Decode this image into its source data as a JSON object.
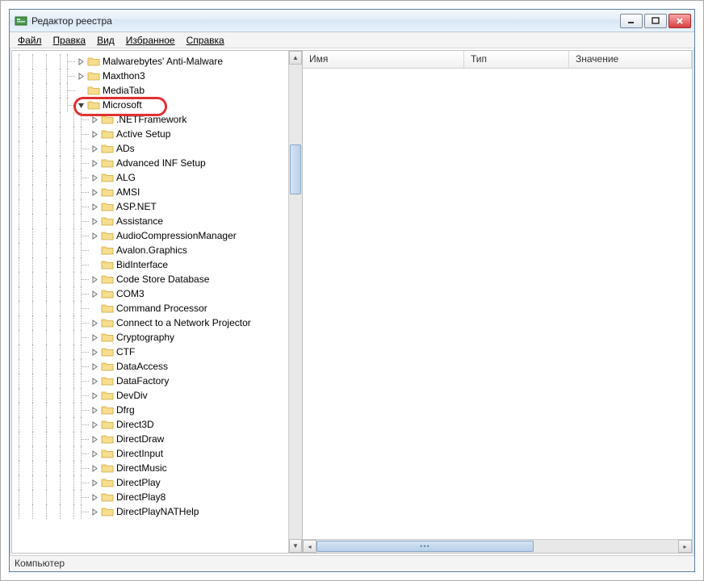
{
  "window": {
    "title": "Редактор реестра"
  },
  "menu": {
    "file": "Файл",
    "edit": "Правка",
    "view": "Вид",
    "favorites": "Избранное",
    "help": "Справка"
  },
  "tree": {
    "top": [
      {
        "label": "Malwarebytes' Anti-Malware",
        "exp": ">"
      },
      {
        "label": "Maxthon3",
        "exp": ">"
      },
      {
        "label": "MediaTab",
        "exp": ""
      }
    ],
    "microsoft": {
      "label": "Microsoft",
      "exp": "v"
    },
    "children": [
      {
        "label": ".NETFramework",
        "exp": ">"
      },
      {
        "label": "Active Setup",
        "exp": ">"
      },
      {
        "label": "ADs",
        "exp": ">"
      },
      {
        "label": "Advanced INF Setup",
        "exp": ">"
      },
      {
        "label": "ALG",
        "exp": ">"
      },
      {
        "label": "AMSI",
        "exp": ">"
      },
      {
        "label": "ASP.NET",
        "exp": ">"
      },
      {
        "label": "Assistance",
        "exp": ">"
      },
      {
        "label": "AudioCompressionManager",
        "exp": ">"
      },
      {
        "label": "Avalon.Graphics",
        "exp": ""
      },
      {
        "label": "BidInterface",
        "exp": ""
      },
      {
        "label": "Code Store Database",
        "exp": ">"
      },
      {
        "label": "COM3",
        "exp": ">"
      },
      {
        "label": "Command Processor",
        "exp": ""
      },
      {
        "label": "Connect to a Network Projector",
        "exp": ">"
      },
      {
        "label": "Cryptography",
        "exp": ">"
      },
      {
        "label": "CTF",
        "exp": ">"
      },
      {
        "label": "DataAccess",
        "exp": ">"
      },
      {
        "label": "DataFactory",
        "exp": ">"
      },
      {
        "label": "DevDiv",
        "exp": ">"
      },
      {
        "label": "Dfrg",
        "exp": ">"
      },
      {
        "label": "Direct3D",
        "exp": ">"
      },
      {
        "label": "DirectDraw",
        "exp": ">"
      },
      {
        "label": "DirectInput",
        "exp": ">"
      },
      {
        "label": "DirectMusic",
        "exp": ">"
      },
      {
        "label": "DirectPlay",
        "exp": ">"
      },
      {
        "label": "DirectPlay8",
        "exp": ">"
      },
      {
        "label": "DirectPlayNATHelp",
        "exp": ">"
      }
    ]
  },
  "list": {
    "col_name": "Имя",
    "col_type": "Тип",
    "col_value": "Значение"
  },
  "status": {
    "path": "Компьютер"
  }
}
